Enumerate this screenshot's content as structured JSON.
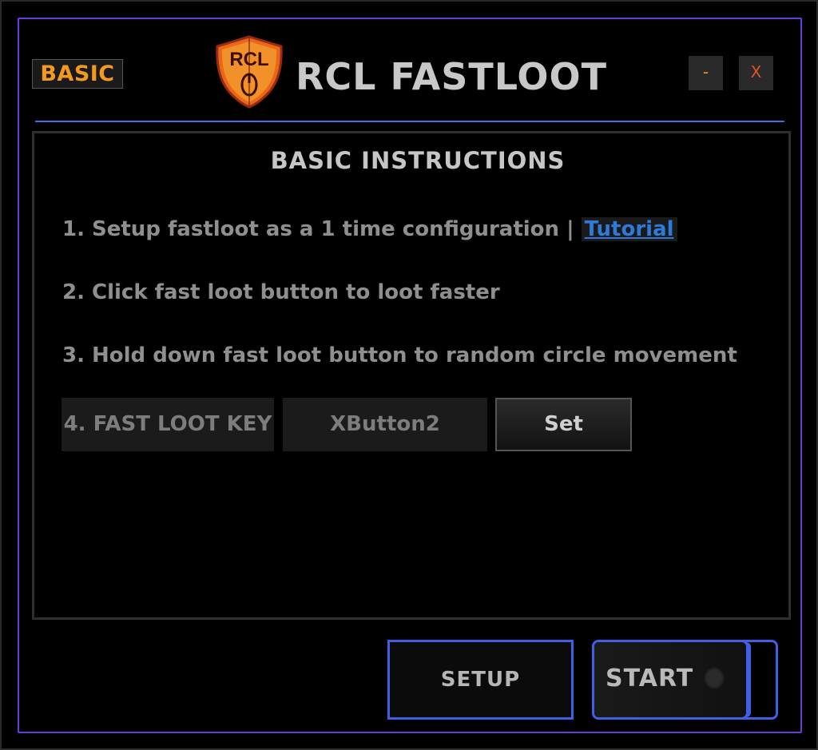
{
  "header": {
    "badge": "BASIC",
    "logo_text": "RCL",
    "title": "RCL FASTLOOT",
    "minimize_label": "-",
    "close_label": "X"
  },
  "panel": {
    "title": "BASIC INSTRUCTIONS",
    "instructions": [
      {
        "text": "1. Setup fastloot as a 1 time configuration | ",
        "link": "Tutorial"
      },
      {
        "text": "2. Click fast loot button to loot faster"
      },
      {
        "text": "3. Hold down fast loot button to random circle movement"
      }
    ],
    "key_label": "4. FAST LOOT KEY",
    "key_value": "XButton2",
    "set_label": "Set"
  },
  "footer": {
    "setup_label": "SETUP",
    "start_label": "START"
  },
  "colors": {
    "accent_orange": "#f39a1e",
    "accent_blue": "#3f5fe6",
    "frame_purple": "#6a3ed6",
    "link_blue": "#2f7ad8"
  }
}
